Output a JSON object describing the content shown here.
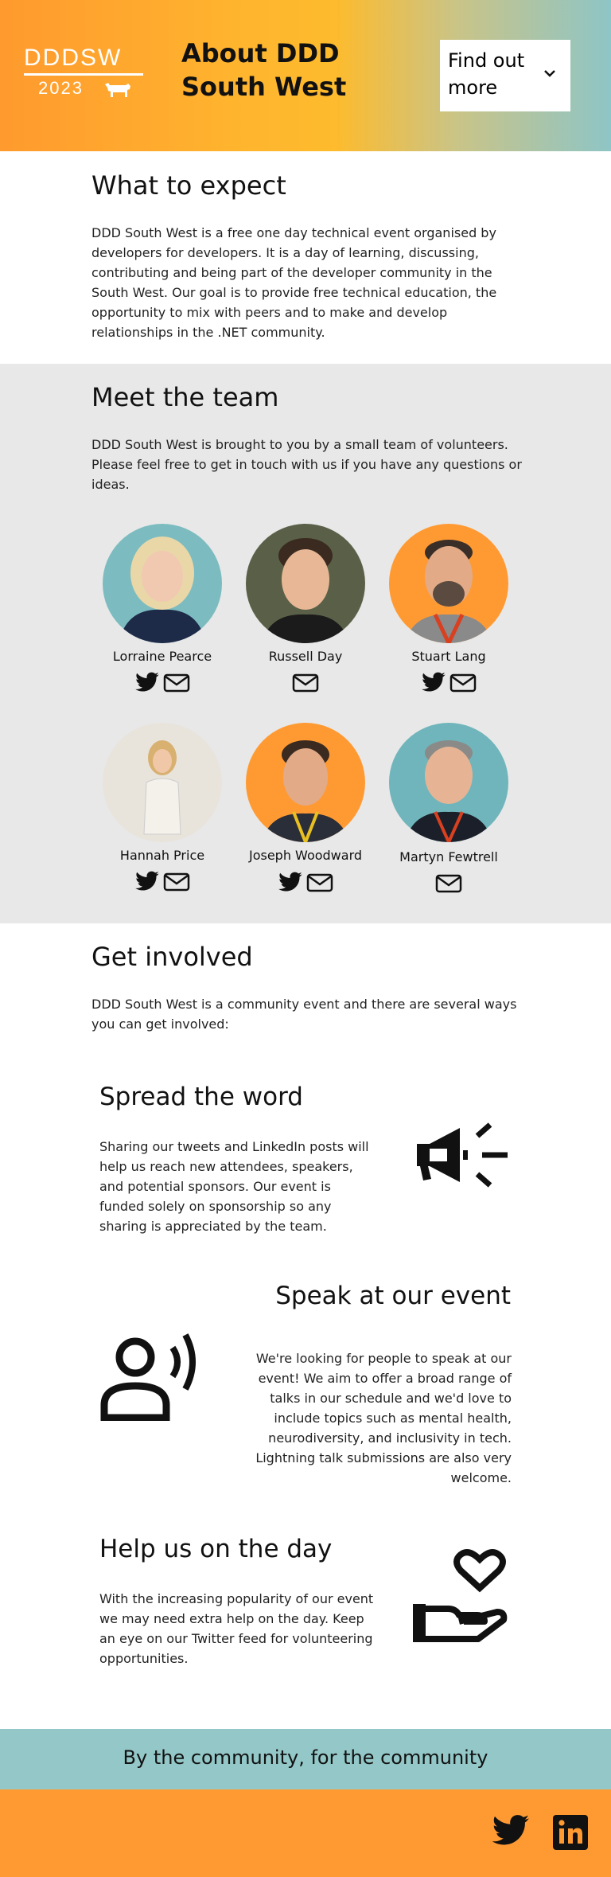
{
  "header": {
    "logo_text": "DDDSW",
    "logo_year": "2023",
    "page_title": "About DDD South West",
    "find_out_more": "Find out more"
  },
  "expect": {
    "heading": "What to expect",
    "body": "DDD South West is a free one day technical event organised by developers for developers. It is a day of learning, discussing, contributing and being part of the developer community in the South West. Our goal is to provide free technical education, the opportunity to mix with peers and to make and develop relationships in the .NET community."
  },
  "team": {
    "heading": "Meet the team",
    "body": "DDD South West is brought to you by a small team of volunteers. Please feel free to get in touch with us if you have any questions or ideas.",
    "members": [
      {
        "name": "Lorraine Pearce",
        "icons": [
          "twitter-icon",
          "email-icon"
        ],
        "bg": "#7cbcc0"
      },
      {
        "name": "Russell Day",
        "icons": [
          "email-icon"
        ],
        "bg": "#5a6048"
      },
      {
        "name": "Stuart Lang",
        "icons": [
          "twitter-icon",
          "email-icon"
        ],
        "bg": "#ff9a33"
      },
      {
        "name": "Hannah Price",
        "icons": [
          "twitter-icon",
          "email-icon"
        ],
        "bg": "#e8e4dc"
      },
      {
        "name": "Joseph Woodward",
        "icons": [
          "twitter-icon",
          "email-icon"
        ],
        "bg": "#ff9a33"
      },
      {
        "name": "Martyn Fewtrell",
        "icons": [
          "email-icon"
        ],
        "bg": "#6fb5bb"
      }
    ]
  },
  "involved": {
    "heading": "Get involved",
    "body": "DDD South West is a community event and there are several ways you can get involved:",
    "cards": [
      {
        "title": "Spread the word",
        "body": "Sharing our tweets and LinkedIn posts will help us reach new attendees, speakers, and potential sponsors. Our event is funded solely on sponsorship so any sharing is appreciated by the team.",
        "icon": "megaphone-icon"
      },
      {
        "title": "Speak at our event",
        "body": "We're looking for people to speak at our event! We aim to offer a broad range of talks in our schedule and we'd love to include topics such as mental health, neurodiversity, and inclusivity in tech. Lightning talk submissions are also very welcome.",
        "icon": "speaker-icon"
      },
      {
        "title": "Help us on the day",
        "body": "With the increasing popularity of our event we may need extra help on the day. Keep an eye on our Twitter feed for volunteering opportunities.",
        "icon": "helping-hand-heart-icon"
      }
    ]
  },
  "band": {
    "text": "By the community, for the community"
  },
  "footer": {
    "icons": [
      "twitter-icon",
      "linkedin-icon"
    ]
  },
  "colors": {
    "orange": "#ff9a33",
    "teal": "#94c8c8",
    "grey": "#e8e8e8"
  }
}
